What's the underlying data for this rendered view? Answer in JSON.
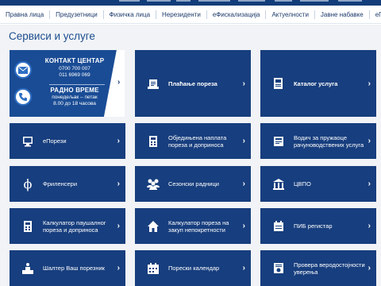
{
  "nav": {
    "items": [
      "Правна лица",
      "Предузетници",
      "Физичка лица",
      "Нерезиденти",
      "еФискализација",
      "Актуелности",
      "Јавне набавке",
      "еПорези"
    ]
  },
  "page": {
    "title": "Сервиси и услуге"
  },
  "contact": {
    "heading": "КОНТАКТ ЦЕНТАР",
    "phone1": "0700 700 007",
    "phone2": "011 6969 069",
    "hours_heading": "РАДНО ВРЕМЕ",
    "hours_days": "понедељак – петак",
    "hours_time": "8.00 до 18 часова"
  },
  "cards": [
    {
      "label": "Плаћање пореза",
      "icon": "receipt-icon"
    },
    {
      "label": "Каталог услуга",
      "icon": "catalog-icon"
    },
    {
      "label": "еПорези",
      "icon": "computer-icon"
    },
    {
      "label": "Обједињена наплата пореза и доприноса",
      "icon": "calculator-icon"
    },
    {
      "label": "Водич за пружаоце рачуноводствених услуга",
      "icon": "guide-icon"
    },
    {
      "label": "Фриленсери",
      "icon": "phi-icon"
    },
    {
      "label": "Сезонски радници",
      "icon": "people-icon"
    },
    {
      "label": "ЦВПО",
      "icon": "building-icon"
    },
    {
      "label": "Калкулатор паушалног пореза и доприноса",
      "icon": "calculator-icon"
    },
    {
      "label": "Калкулатор пореза на закуп непокретности",
      "icon": "house-icon"
    },
    {
      "label": "ПИБ регистар",
      "icon": "register-icon"
    },
    {
      "label": "Шалтер Ваш порезник",
      "icon": "counter-icon"
    },
    {
      "label": "Порески календар",
      "icon": "calendar-icon"
    },
    {
      "label": "Провера веродостојности уверења",
      "icon": "certificate-icon"
    }
  ],
  "colors": {
    "card": "#173e7e",
    "contact": "#1a4c95",
    "accent": "#1c4d8f"
  }
}
